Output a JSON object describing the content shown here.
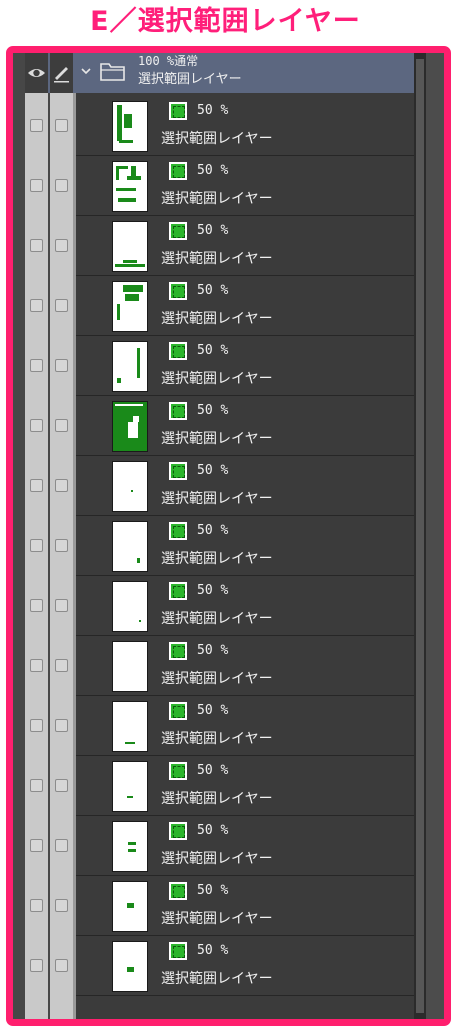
{
  "heading": "E／選択範囲レイヤー",
  "colors": {
    "accent": "#ff1f6e",
    "selection_green": "#2bb52b",
    "folder_header": "#5c6780"
  },
  "header": {
    "eye_icon": "eye-icon",
    "pen_icon": "pen-icon",
    "folder": {
      "opacity_mode": "100 %通常",
      "name": "選択範囲レイヤー"
    }
  },
  "layers": [
    {
      "opacity": "50 %",
      "name": "選択範囲レイヤー"
    },
    {
      "opacity": "50 %",
      "name": "選択範囲レイヤー"
    },
    {
      "opacity": "50 %",
      "name": "選択範囲レイヤー"
    },
    {
      "opacity": "50 %",
      "name": "選択範囲レイヤー"
    },
    {
      "opacity": "50 %",
      "name": "選択範囲レイヤー"
    },
    {
      "opacity": "50 %",
      "name": "選択範囲レイヤー"
    },
    {
      "opacity": "50 %",
      "name": "選択範囲レイヤー"
    },
    {
      "opacity": "50 %",
      "name": "選択範囲レイヤー"
    },
    {
      "opacity": "50 %",
      "name": "選択範囲レイヤー"
    },
    {
      "opacity": "50 %",
      "name": "選択範囲レイヤー"
    },
    {
      "opacity": "50 %",
      "name": "選択範囲レイヤー"
    },
    {
      "opacity": "50 %",
      "name": "選択範囲レイヤー"
    },
    {
      "opacity": "50 %",
      "name": "選択範囲レイヤー"
    },
    {
      "opacity": "50 %",
      "name": "選択範囲レイヤー"
    },
    {
      "opacity": "50 %",
      "name": "選択範囲レイヤー"
    }
  ]
}
